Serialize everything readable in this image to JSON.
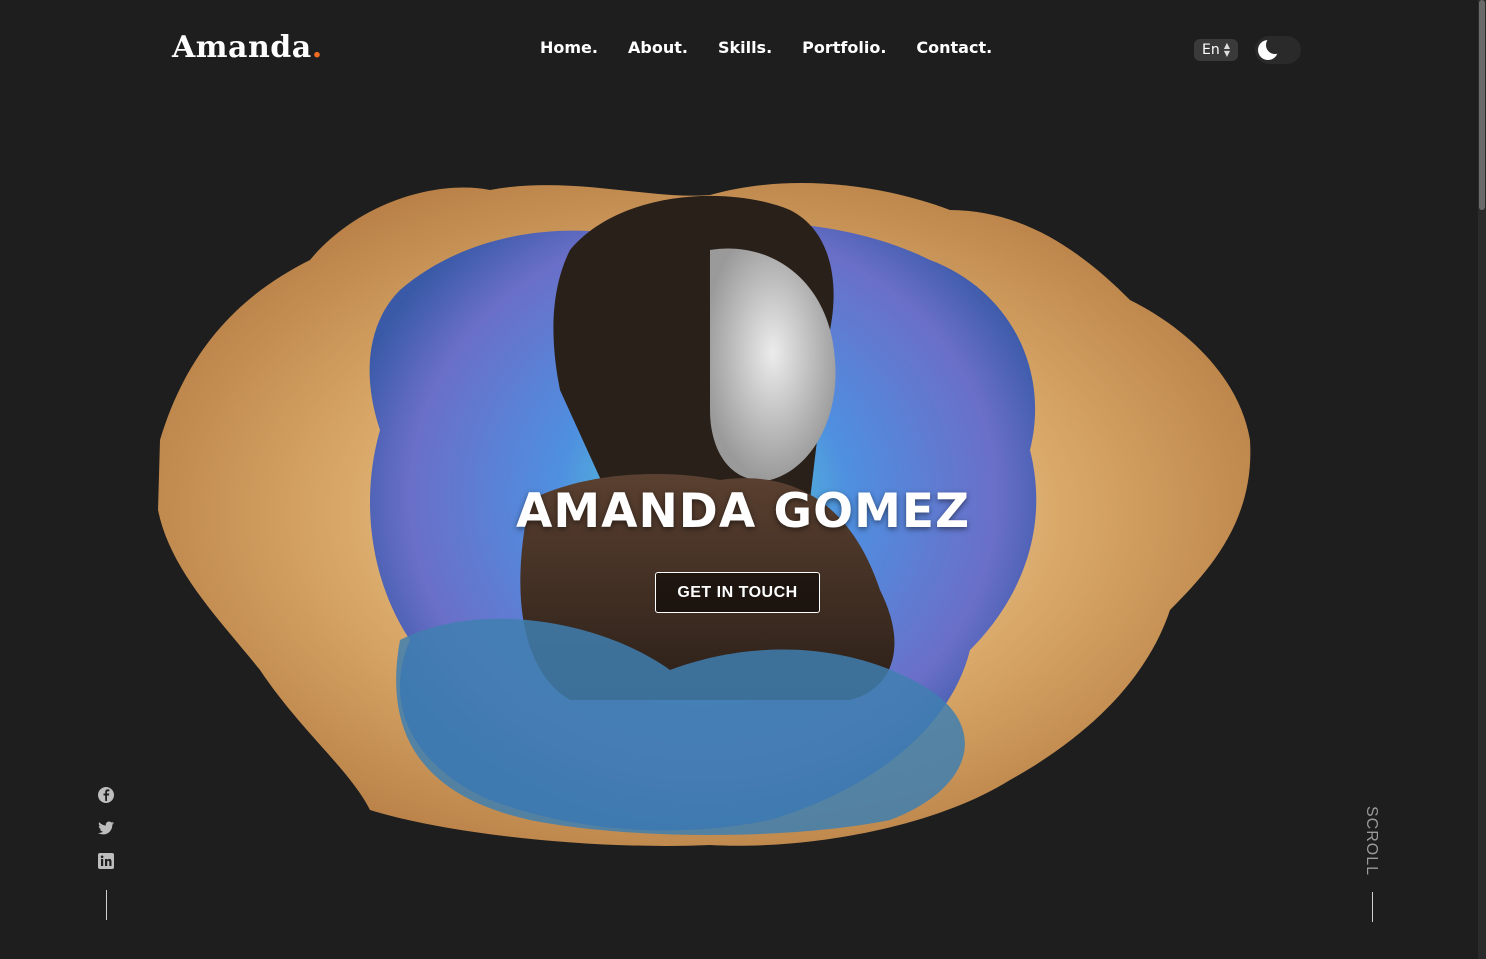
{
  "header": {
    "logo_text": "Amanda",
    "logo_dot": ".",
    "nav": [
      {
        "label": "Home."
      },
      {
        "label": "About."
      },
      {
        "label": "Skills."
      },
      {
        "label": "Portfolio."
      },
      {
        "label": "Contact."
      }
    ],
    "language": "En",
    "theme_icon": "moon-icon"
  },
  "hero": {
    "name": "AMANDA GOMEZ",
    "cta_label": "GET IN TOUCH"
  },
  "social": [
    "facebook-icon",
    "twitter-icon",
    "linkedin-icon"
  ],
  "scroll_label": "SCROLL",
  "colors": {
    "background": "#1e1e1e",
    "accent": "#f26b21"
  }
}
